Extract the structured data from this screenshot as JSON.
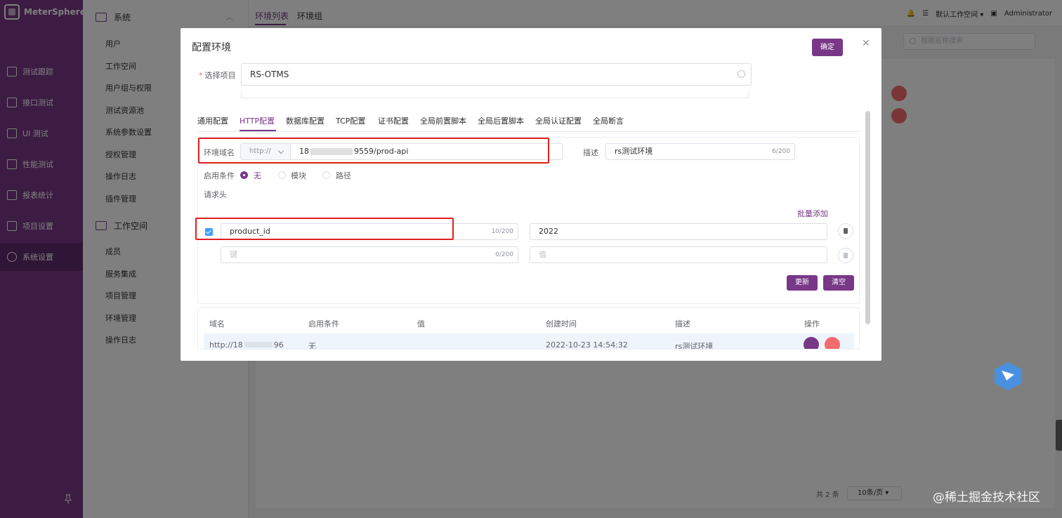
{
  "app": {
    "name": "MeterSphere"
  },
  "left_nav": {
    "items": [
      {
        "label": "测试跟踪",
        "icon": "clipboard-icon"
      },
      {
        "label": "接口测试",
        "icon": "api-icon"
      },
      {
        "label": "UI 测试",
        "icon": "ui-icon"
      },
      {
        "label": "性能测试",
        "icon": "chart-icon"
      },
      {
        "label": "报表统计",
        "icon": "report-icon"
      },
      {
        "label": "项目设置",
        "icon": "folder-icon"
      },
      {
        "label": "系统设置",
        "icon": "gear-icon"
      }
    ],
    "active": "系统设置"
  },
  "sub_menu": {
    "system_group": "系统",
    "system_items": [
      "用户",
      "工作空间",
      "用户组与权限",
      "测试资源池",
      "系统参数设置",
      "授权管理",
      "操作日志",
      "插件管理"
    ],
    "workspace_group": "工作空间",
    "workspace_items": [
      "成员",
      "服务集成",
      "项目管理",
      "环境管理",
      "操作日志"
    ]
  },
  "top": {
    "tabs": [
      "环境列表",
      "环境组"
    ],
    "active_tab": "环境列表",
    "workspace": "默认工作空间",
    "user": "Administrator",
    "search_placeholder": "根据名称搜索"
  },
  "background_footer": {
    "total": "共 2 条",
    "page_size": "10条/页"
  },
  "dialog": {
    "title": "配置环境",
    "confirm": "确定",
    "project_label": "选择项目",
    "project_value": "RS-OTMS",
    "tabs": [
      "通用配置",
      "HTTP配置",
      "数据库配置",
      "TCP配置",
      "证书配置",
      "全局前置脚本",
      "全局后置脚本",
      "全局认证配置",
      "全局断言"
    ],
    "active_tab": "HTTP配置",
    "http": {
      "domain_label": "环境域名",
      "protocol": "http://",
      "domain_prefix": "18",
      "domain_suffix": "9559/prod-api",
      "desc_label": "描述",
      "desc_value": "rs测试环境",
      "desc_count": "6/200",
      "condition_label": "启用条件",
      "conditions": [
        "无",
        "模块",
        "路径"
      ],
      "selected_condition": "无",
      "headers_label": "请求头",
      "batch_add": "批量添加",
      "header_rows": [
        {
          "key": "product_id",
          "key_count": "10/200",
          "value": "2022",
          "checked": true
        },
        {
          "key": "",
          "key_placeholder": "键",
          "key_count": "0/200",
          "value": "",
          "value_placeholder": "值",
          "checked": false
        }
      ],
      "update_btn": "更新",
      "clear_btn": "清空"
    },
    "table": {
      "columns": [
        "域名",
        "启用条件",
        "值",
        "创建时间",
        "描述",
        "操作"
      ],
      "rows": [
        {
          "domain_prefix": "http://18",
          "domain_suffix": "96",
          "condition": "无",
          "value": "",
          "created": "2022-10-23 14:54:32",
          "desc": "rs测试环境"
        }
      ]
    }
  },
  "watermark": "@稀土掘金技术社区"
}
